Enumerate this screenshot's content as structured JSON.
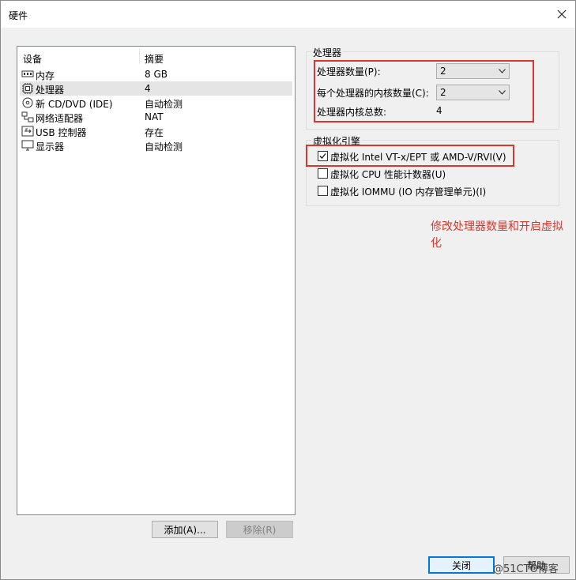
{
  "window": {
    "title": "硬件"
  },
  "device_list": {
    "columns": [
      "设备",
      "摘要"
    ],
    "rows": [
      {
        "icon": "memory-icon",
        "name": "内存",
        "summary": "8 GB"
      },
      {
        "icon": "processor-icon",
        "name": "处理器",
        "summary": "4"
      },
      {
        "icon": "cd-dvd-icon",
        "name": "新 CD/DVD (IDE)",
        "summary": "自动检测"
      },
      {
        "icon": "network-adapter-icon",
        "name": "网络适配器",
        "summary": "NAT"
      },
      {
        "icon": "usb-icon",
        "name": "USB 控制器",
        "summary": "存在"
      },
      {
        "icon": "display-icon",
        "name": "显示器",
        "summary": "自动检测"
      }
    ],
    "add_label": "添加(A)...",
    "remove_label": "移除(R)"
  },
  "processor_group": {
    "title": "处理器",
    "count_label": "处理器数量(P):",
    "count_value": "2",
    "cores_label": "每个处理器的内核数量(C):",
    "cores_value": "2",
    "total_label": "处理器内核总数:",
    "total_value": "4"
  },
  "virtualization_group": {
    "title": "虚拟化引擎",
    "options": [
      {
        "label": "虚拟化 Intel VT-x/EPT 或 AMD-V/RVI(V)",
        "checked": true
      },
      {
        "label": "虚拟化 CPU 性能计数器(U)",
        "checked": false
      },
      {
        "label": "虚拟化 IOMMU (IO 内存管理单元)(I)",
        "checked": false
      }
    ]
  },
  "annotation": {
    "text": "修改处理器数量和开启虚拟化"
  },
  "footer": {
    "close_label": "关闭",
    "help_label": "帮助"
  },
  "watermark": {
    "text": "@51CTO博客"
  },
  "colors": {
    "highlight": "#d9362d",
    "accent": "#0078d7"
  }
}
